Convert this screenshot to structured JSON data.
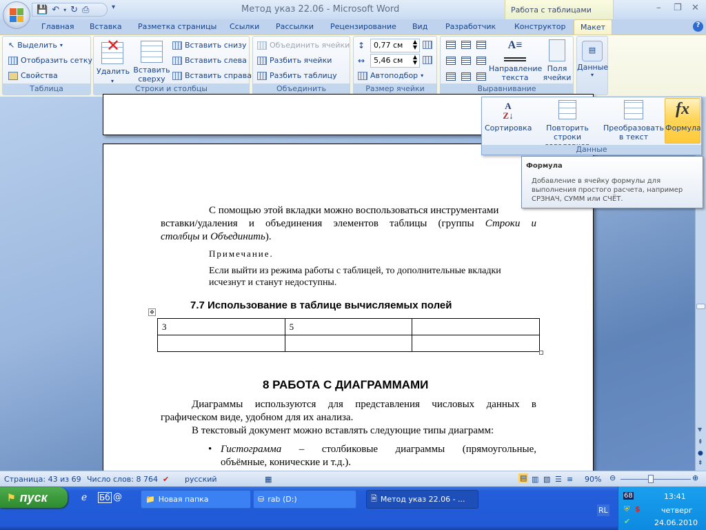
{
  "window": {
    "title": "Метод указ 22.06  -  Microsoft Word",
    "context_tab": "Работа с таблицами",
    "minimize": "–",
    "restore": "❐",
    "close": "✕"
  },
  "tabs": [
    "Главная",
    "Вставка",
    "Разметка страницы",
    "Ссылки",
    "Рассылки",
    "Рецензирование",
    "Вид",
    "Разработчик",
    "Конструктор",
    "Макет"
  ],
  "ribbon": {
    "table": {
      "label": "Таблица",
      "select": "Выделить",
      "show_grid": "Отобразить сетку",
      "properties": "Свойства"
    },
    "rows_cols": {
      "label": "Строки и столбцы",
      "delete": "Удалить",
      "insert_above_1": "Вставить",
      "insert_above_2": "сверху",
      "insert_below": "Вставить снизу",
      "insert_left": "Вставить слева",
      "insert_right": "Вставить справа"
    },
    "merge": {
      "label": "Объединить",
      "merge_cells": "Объединить ячейки",
      "split_cells": "Разбить ячейки",
      "split_table": "Разбить таблицу"
    },
    "cell_size": {
      "label": "Размер ячейки",
      "height": "0,77 см",
      "width": "5,46 см",
      "autofit": "Автоподбор"
    },
    "alignment": {
      "label": "Выравнивание",
      "text_direction_1": "Направление",
      "text_direction_2": "текста",
      "cell_margins_1": "Поля",
      "cell_margins_2": "ячейки"
    },
    "data": {
      "label": "Данные"
    }
  },
  "data_popup": {
    "sort": "Сортировка",
    "repeat_1": "Повторить строки",
    "repeat_2": "заголовков",
    "convert_1": "Преобразовать",
    "convert_2": "в текст",
    "formula": "Формула",
    "label": "Данные"
  },
  "tooltip": {
    "title": "Формула",
    "body": "Добавление в ячейку формулы для выполнения простого расчета, например СРЗНАЧ, СУММ или СЧЁТ."
  },
  "document": {
    "p1_line1": "С помощью этой вкладки можно воспользоваться инструментами",
    "p1_line2a": "вставки/удаления и объединения элементов таблицы (группы ",
    "p1_line2b": "Строки и",
    "p1_line3a": "столбцы",
    "p1_line3b": " и ",
    "p1_line3c": "Объединить",
    "p1_line3d": ").",
    "note_label": "Примечание.",
    "note_line1": "Если выйти из режима работы с таблицей, то дополнительные вкладки",
    "note_line2": "исчезнут и станут недоступны.",
    "heading77": "7.7 Использование в таблице  вычисляемых полей",
    "table": [
      [
        "3",
        "5",
        ""
      ],
      [
        "",
        "",
        ""
      ]
    ],
    "heading8": "8 РАБОТА С ДИАГРАММАМИ",
    "p2_line1": "Диаграммы используются для представления числовых данных в",
    "p2_line2": "графическом виде, удобном для их анализа.",
    "p3": "В текстовый документ можно вставлять следующие типы диаграмм:",
    "bullet_italic": "Гистограмма",
    "bullet_line1": " – столбиковые диаграммы (прямоугольные,",
    "bullet_line2": "объёмные, конические и т.д.)."
  },
  "status": {
    "page": "Страница: 43 из 69",
    "words": "Число слов: 8 764",
    "language": "русский",
    "zoom": "90%"
  },
  "taskbar": {
    "start": "пуск",
    "tasks": [
      "Новая папка",
      "rab (D:)",
      "Метод указ 22.06 - ..."
    ],
    "lang": "RL",
    "tray_num": "68",
    "time": "13:41",
    "day": "четверг",
    "date": "24.06.2010"
  }
}
